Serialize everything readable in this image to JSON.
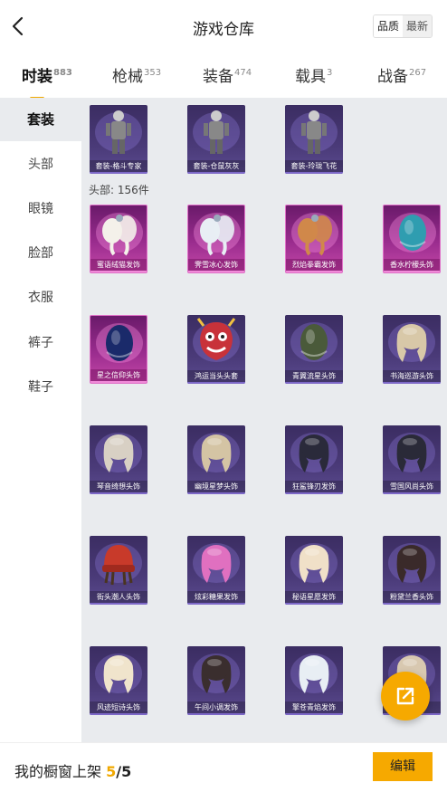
{
  "header": {
    "title": "游戏仓库",
    "sort_options": [
      "品质",
      "最新"
    ],
    "sort_active": "品质"
  },
  "tabs": [
    {
      "label": "时装",
      "count": "883",
      "active": true
    },
    {
      "label": "枪械",
      "count": "353",
      "active": false
    },
    {
      "label": "装备",
      "count": "474",
      "active": false
    },
    {
      "label": "载具",
      "count": "3",
      "active": false
    },
    {
      "label": "战备",
      "count": "267",
      "active": false
    }
  ],
  "sidebar": {
    "items": [
      {
        "label": "套装",
        "active": true
      },
      {
        "label": "头部",
        "active": false
      },
      {
        "label": "眼镜",
        "active": false
      },
      {
        "label": "脸部",
        "active": false
      },
      {
        "label": "衣服",
        "active": false
      },
      {
        "label": "裤子",
        "active": false
      },
      {
        "label": "鞋子",
        "active": false
      }
    ]
  },
  "suits": [
    {
      "name": "套装-格斗专家",
      "rarity": "purple",
      "icon": "suit-figure-icon"
    },
    {
      "name": "套装-仓鼠灰灰",
      "rarity": "purple",
      "icon": "suit-figure-icon"
    },
    {
      "name": "套装-玲珑飞花",
      "rarity": "purple",
      "icon": "suit-figure-icon"
    }
  ],
  "head_section": {
    "label": "头部: 156件"
  },
  "head_items": [
    {
      "name": "蜜语绒猫发饰",
      "rarity": "pink",
      "icon": "hair-accessory-icon",
      "color": "#f4f1ea"
    },
    {
      "name": "霁雪冰心发饰",
      "rarity": "pink",
      "icon": "hair-accessory-icon",
      "color": "#e8eef4"
    },
    {
      "name": "烈焰拳霸发饰",
      "rarity": "pink",
      "icon": "hair-accessory-icon",
      "color": "#d0884a"
    },
    {
      "name": "香水柠檬头饰",
      "rarity": "pink",
      "icon": "headwear-icon",
      "color": "#2f9db0"
    },
    {
      "name": "星之信仰头饰",
      "rarity": "pink",
      "icon": "headwear-icon",
      "color": "#1a2a6a"
    },
    {
      "name": "鸿运当头头套",
      "rarity": "purple",
      "icon": "mask-icon",
      "color": "#c8323a"
    },
    {
      "name": "青翼流星头饰",
      "rarity": "purple",
      "icon": "headwear-icon",
      "color": "#4a5a3a"
    },
    {
      "name": "书海巡游头饰",
      "rarity": "purple",
      "icon": "hair-icon",
      "color": "#d8c8a8"
    },
    {
      "name": "琴音绮想头饰",
      "rarity": "purple",
      "icon": "hair-icon",
      "color": "#d8d0c4"
    },
    {
      "name": "幽境星梦头饰",
      "rarity": "purple",
      "icon": "hair-icon",
      "color": "#d4c4a4"
    },
    {
      "name": "狂鲨锋刃发饰",
      "rarity": "purple",
      "icon": "hair-icon",
      "color": "#2a2a3a"
    },
    {
      "name": "雪国风尚头饰",
      "rarity": "purple",
      "icon": "hair-icon",
      "color": "#2a2a38"
    },
    {
      "name": "街头潮人头饰",
      "rarity": "purple",
      "icon": "beanie-icon",
      "color": "#c83a2a"
    },
    {
      "name": "炫彩糖果发饰",
      "rarity": "purple",
      "icon": "hair-icon",
      "color": "#e070c0"
    },
    {
      "name": "秘语星愿发饰",
      "rarity": "purple",
      "icon": "hair-icon",
      "color": "#f0e0c8"
    },
    {
      "name": "粉黛兰香头饰",
      "rarity": "purple",
      "icon": "hair-icon",
      "color": "#3a2a2a"
    },
    {
      "name": "风迹短诗头饰",
      "rarity": "purple",
      "icon": "hair-icon",
      "color": "#f0e4cc"
    },
    {
      "name": "午间小调发饰",
      "rarity": "purple",
      "icon": "hair-icon",
      "color": "#3a2e2e"
    },
    {
      "name": "擎苍青焰发饰",
      "rarity": "purple",
      "icon": "hair-icon",
      "color": "#e8eef4"
    },
    {
      "name": "",
      "rarity": "purple",
      "icon": "hair-icon",
      "color": "#d8c8b0"
    }
  ],
  "footer": {
    "label": "我的橱窗上架",
    "shelved": "5",
    "slash": "/",
    "total": "5",
    "edit_label": "编辑"
  },
  "colors": {
    "accent": "#f6a900",
    "sidebar_active_bg": "#e9ebee"
  }
}
